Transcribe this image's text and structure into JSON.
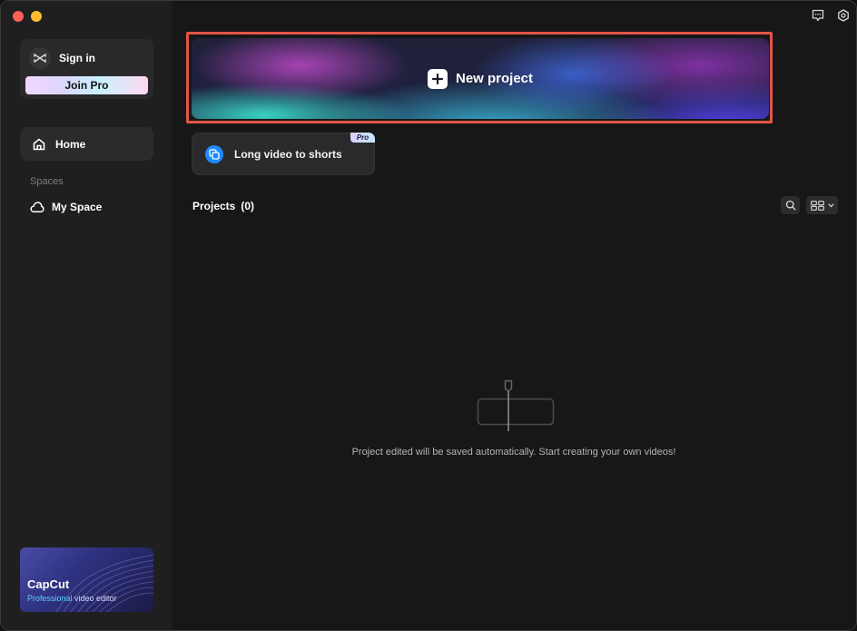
{
  "app": {
    "name": "CapCut"
  },
  "sidebar": {
    "account": {
      "signin_label": "Sign in",
      "join_pro_label": "Join Pro",
      "logo_icon": "capcut-logo-icon"
    },
    "nav": [
      {
        "label": "Home",
        "icon": "home-icon",
        "active": true
      }
    ],
    "spaces_heading": "Spaces",
    "spaces": [
      {
        "label": "My Space",
        "icon": "cloud-icon"
      }
    ],
    "promo": {
      "title": "CapCut",
      "subtitle_accent": "Professional",
      "subtitle_rest": " video editor"
    }
  },
  "topbar": {
    "icons": [
      "feedback-icon",
      "settings-icon"
    ]
  },
  "main": {
    "new_project": {
      "label": "New project",
      "icon": "plus-icon"
    },
    "long_video": {
      "label": "Long video to shorts",
      "badge": "Pro",
      "icon": "shorts-icon"
    },
    "projects": {
      "title": "Projects",
      "count": "(0)",
      "empty_message": "Project edited will be saved automatically. Start creating your own videos!"
    }
  },
  "colors": {
    "accent_highlight": "#e25547",
    "sidebar_bg": "#1f1f20",
    "main_bg": "#171717",
    "long_video_icon_bg": "#1e8bff"
  }
}
